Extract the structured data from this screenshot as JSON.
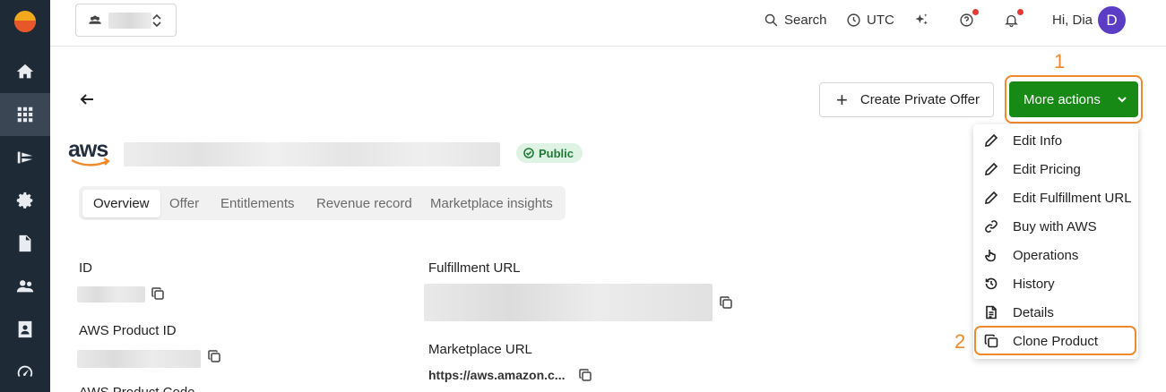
{
  "topbar": {
    "search_label": "Search",
    "timezone_label": "UTC",
    "greeting": "Hi, Dia",
    "avatar_initial": "D"
  },
  "main": {
    "create_offer_label": "Create Private Offer",
    "more_actions_label": "More actions",
    "status_badge": "Public",
    "tabs": [
      {
        "label": "Overview"
      },
      {
        "label": "Offer"
      },
      {
        "label": "Entitlements"
      },
      {
        "label": "Revenue record"
      },
      {
        "label": "Marketplace insights"
      }
    ],
    "fields": {
      "id_label": "ID",
      "aws_product_id_label": "AWS Product ID",
      "aws_product_code_label": "AWS Product Code",
      "fulfillment_url_label": "Fulfillment URL",
      "marketplace_url_label": "Marketplace URL",
      "marketplace_url_value": "https://aws.amazon.c..."
    }
  },
  "menu": {
    "items": [
      {
        "label": "Edit Info",
        "icon": "pencil-icon"
      },
      {
        "label": "Edit Pricing",
        "icon": "pencil-icon"
      },
      {
        "label": "Edit Fulfillment URL",
        "icon": "pencil-icon"
      },
      {
        "label": "Buy with AWS",
        "icon": "link-icon"
      },
      {
        "label": "Operations",
        "icon": "pointer-icon"
      },
      {
        "label": "History",
        "icon": "history-icon"
      },
      {
        "label": "Details",
        "icon": "document-icon"
      },
      {
        "label": "Clone Product",
        "icon": "copy-icon"
      }
    ]
  },
  "annotations": {
    "step1": "1",
    "step2": "2",
    "highlight_color": "#f08a2c"
  },
  "colors": {
    "sidebar_bg": "#1f2a37",
    "primary_green": "#178a16",
    "avatar_bg": "#5b3cc4"
  }
}
